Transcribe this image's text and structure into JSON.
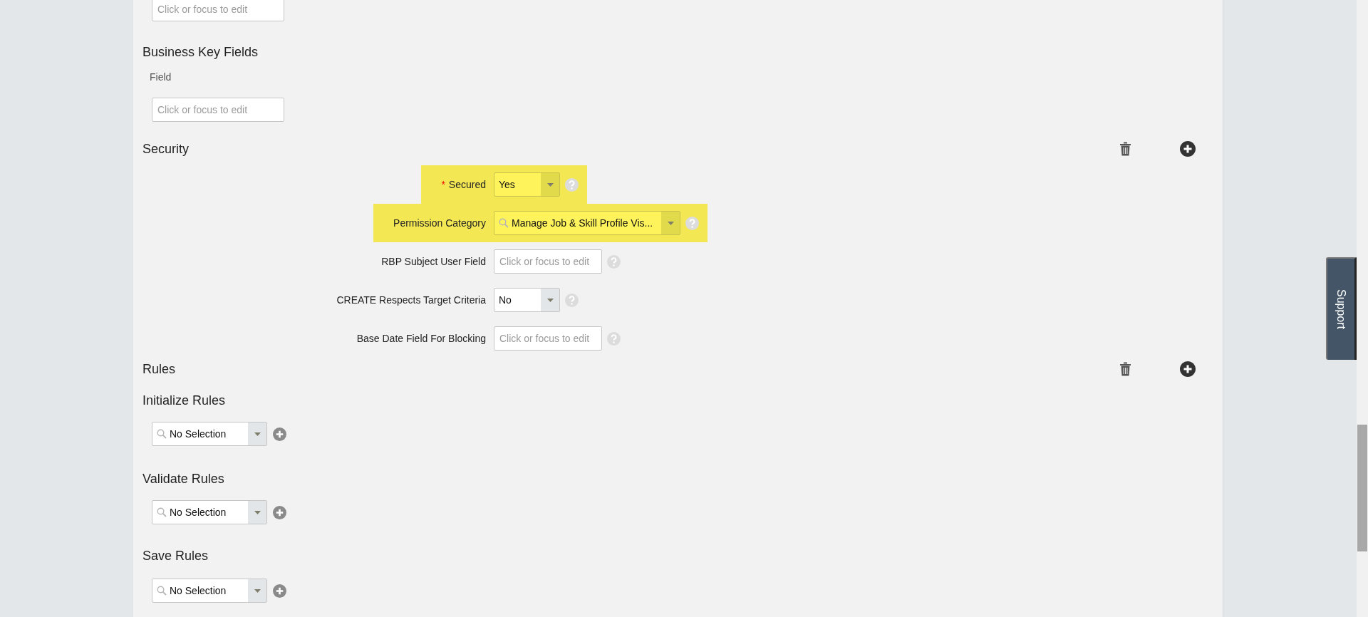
{
  "top_field": {
    "placeholder": "Click or focus to edit"
  },
  "business_key_fields": {
    "title": "Business Key Fields",
    "column": "Field",
    "field": {
      "placeholder": "Click or focus to edit"
    }
  },
  "security": {
    "title": "Security",
    "fields": [
      {
        "kind": "select",
        "label": "Secured",
        "required_mark": "*",
        "value": "Yes",
        "search": false,
        "highlighted": true
      },
      {
        "kind": "select",
        "label": "Permission Category",
        "value": "Manage Job & Skill Profile Vis...",
        "search": true,
        "highlighted": true
      },
      {
        "kind": "text",
        "label": "RBP Subject User Field",
        "placeholder": "Click or focus to edit",
        "highlighted": false
      },
      {
        "kind": "select",
        "label": "CREATE Respects Target Criteria",
        "value": "No",
        "search": false,
        "highlighted": false
      },
      {
        "kind": "text",
        "label": "Base Date Field For Blocking",
        "placeholder": "Click or focus to edit",
        "highlighted": false
      }
    ]
  },
  "rules": {
    "title": "Rules",
    "groups": [
      {
        "title": "Initialize Rules",
        "value": "No Selection"
      },
      {
        "title": "Validate Rules",
        "value": "No Selection"
      },
      {
        "title": "Save Rules",
        "value": "No Selection"
      }
    ]
  },
  "support_tab": "Support"
}
